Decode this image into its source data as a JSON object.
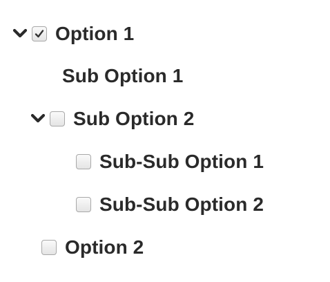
{
  "tree": {
    "items": [
      {
        "label": "Option 1",
        "checked": true,
        "expanded": true
      },
      {
        "label": "Sub Option 1"
      },
      {
        "label": "Sub Option 2",
        "checked": false,
        "expanded": true
      },
      {
        "label": "Sub-Sub Option 1",
        "checked": false
      },
      {
        "label": "Sub-Sub Option 2",
        "checked": false
      },
      {
        "label": "Option 2",
        "checked": false
      }
    ]
  }
}
